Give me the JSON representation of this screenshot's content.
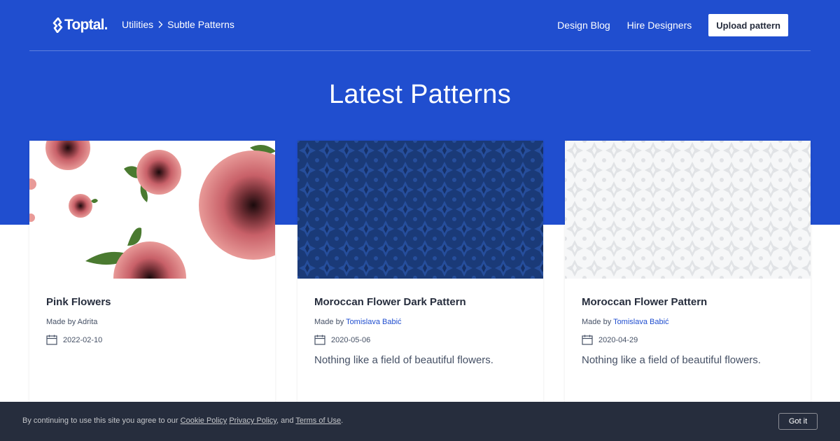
{
  "header": {
    "logo_text": "Toptal",
    "breadcrumb": [
      "Utilities",
      "Subtle Patterns"
    ],
    "nav": [
      "Design Blog",
      "Hire Designers"
    ],
    "upload_label": "Upload pattern"
  },
  "hero": {
    "title": "Latest Patterns"
  },
  "cards": [
    {
      "title": "Pink Flowers",
      "made_by_prefix": "Made by",
      "author": "Adrita",
      "author_link": false,
      "date": "2022-02-10",
      "description": ""
    },
    {
      "title": "Moroccan Flower Dark Pattern",
      "made_by_prefix": "Made by",
      "author": "Tomislava Babić",
      "author_link": true,
      "date": "2020-05-06",
      "description": "Nothing like a field of beautiful flowers."
    },
    {
      "title": "Moroccan Flower Pattern",
      "made_by_prefix": "Made by",
      "author": "Tomislava Babić",
      "author_link": true,
      "date": "2020-04-29",
      "description": "Nothing like a field of beautiful flowers."
    }
  ],
  "cookie": {
    "prefix": "By continuing to use this site you agree to our",
    "cookie_policy": "Cookie Policy",
    "privacy_policy": "Privacy Policy",
    "and": ", and",
    "terms": "Terms of Use",
    "suffix": ".",
    "button": "Got it"
  },
  "colors": {
    "brand_blue": "#204ecf",
    "dark": "#262d3d",
    "link": "#204ecf"
  },
  "icons": [
    "toptal-logo-icon",
    "chevron-right-icon",
    "calendar-icon"
  ]
}
